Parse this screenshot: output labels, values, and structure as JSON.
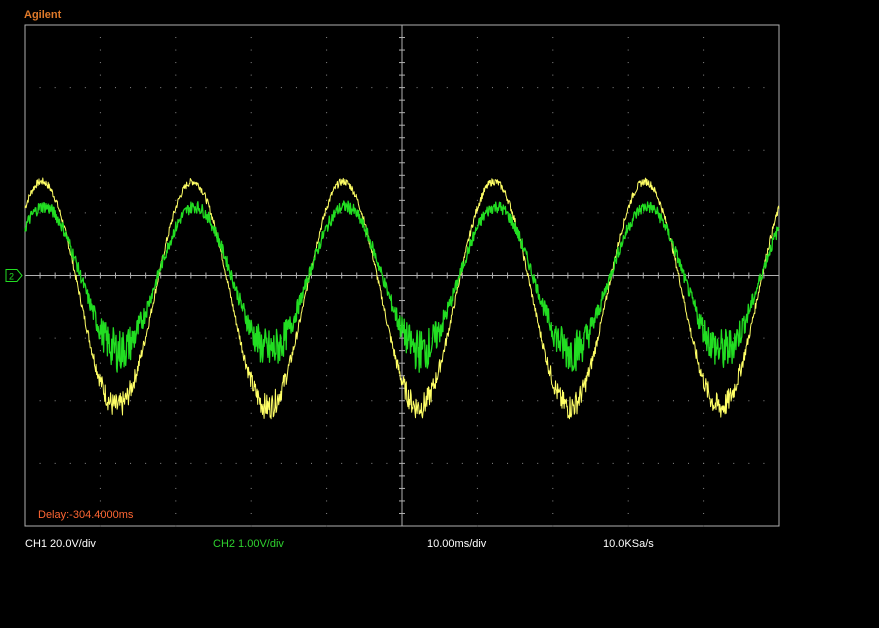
{
  "brand": "Agilent",
  "footer": {
    "ch1_scale": "CH1 20.0V/div",
    "ch2_scale": "CH2 1.00V/div",
    "timebase": "10.00ms/div",
    "sample_rate": "10.0KSa/s"
  },
  "colors": {
    "background": "#000000",
    "grid": "#8a8a8a",
    "ch1": "#ffff66",
    "ch2": "#22dd22",
    "brand": "#e07a2a",
    "delay_text": "#ff6633"
  },
  "chart_data": {
    "type": "line",
    "title": "",
    "xlabel": "",
    "ylabel": "",
    "divisions": {
      "x": 10,
      "y": 8
    },
    "delay_label": "Delay:-304.4000ms",
    "xlim": [
      0,
      100
    ],
    "ylim": [
      -4,
      4
    ],
    "series": [
      {
        "name": "CH1",
        "color": "#ffff66",
        "frequency_hz": 50,
        "amplitude_div": 1.8,
        "offset_div": -0.3,
        "phase_deg": 50,
        "noise_div": 0.06
      },
      {
        "name": "CH2",
        "color": "#22dd22",
        "frequency_hz": 50,
        "amplitude_div": 1.15,
        "offset_div": -0.05,
        "phase_deg": 45,
        "noise_div": 0.1
      }
    ]
  }
}
